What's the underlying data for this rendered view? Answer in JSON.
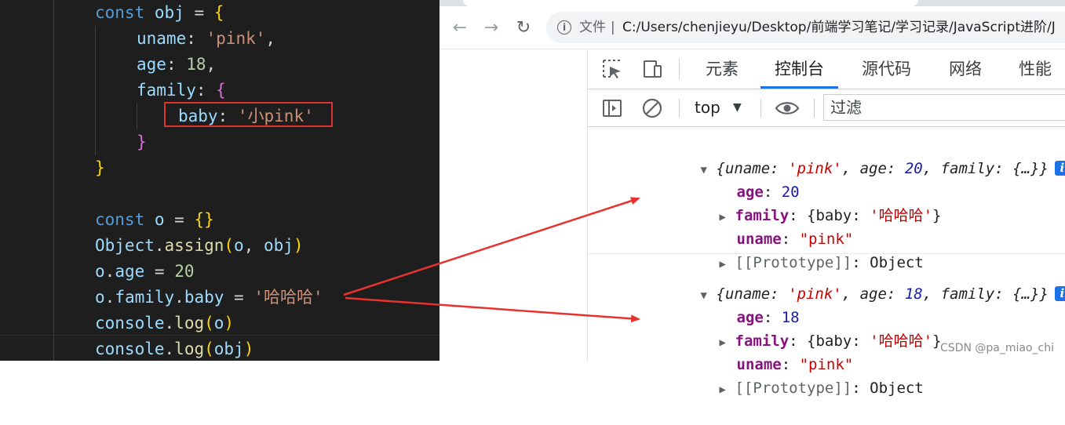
{
  "editor": {
    "lines": [
      {
        "id": "l1",
        "tokens": [
          [
            "kw",
            "const "
          ],
          [
            "var",
            "obj"
          ],
          [
            "vr",
            " = "
          ],
          [
            "br1",
            "{"
          ]
        ]
      },
      {
        "id": "l2",
        "tokens": [
          [
            "var",
            "uname"
          ],
          [
            "vr",
            ": "
          ],
          [
            "str",
            "'pink'"
          ],
          [
            "vr",
            ","
          ]
        ]
      },
      {
        "id": "l3",
        "tokens": [
          [
            "var",
            "age"
          ],
          [
            "vr",
            ": "
          ],
          [
            "num",
            "18"
          ],
          [
            "vr",
            ","
          ]
        ]
      },
      {
        "id": "l4",
        "tokens": [
          [
            "var",
            "family"
          ],
          [
            "vr",
            ": "
          ],
          [
            "br2",
            "{"
          ]
        ]
      },
      {
        "id": "l5",
        "tokens": [
          [
            "var",
            "baby"
          ],
          [
            "vr",
            ": "
          ],
          [
            "str",
            "'小pink'"
          ]
        ]
      },
      {
        "id": "l6",
        "tokens": [
          [
            "br2",
            "}"
          ]
        ]
      },
      {
        "id": "l7",
        "tokens": [
          [
            "br1",
            "}"
          ]
        ]
      },
      {
        "id": "l8",
        "tokens": []
      },
      {
        "id": "l9",
        "tokens": [
          [
            "kw",
            "const "
          ],
          [
            "var",
            "o"
          ],
          [
            "vr",
            " = "
          ],
          [
            "br1",
            "{}"
          ]
        ]
      },
      {
        "id": "l10",
        "tokens": [
          [
            "var",
            "Object"
          ],
          [
            "vr",
            "."
          ],
          [
            "fn",
            "assign"
          ],
          [
            "br1",
            "("
          ],
          [
            "var",
            "o"
          ],
          [
            "vr",
            ", "
          ],
          [
            "var",
            "obj"
          ],
          [
            "br1",
            ")"
          ]
        ]
      },
      {
        "id": "l11",
        "tokens": [
          [
            "var",
            "o"
          ],
          [
            "vr",
            "."
          ],
          [
            "var",
            "age"
          ],
          [
            "vr",
            " = "
          ],
          [
            "num",
            "20"
          ]
        ]
      },
      {
        "id": "l12",
        "tokens": [
          [
            "var",
            "o"
          ],
          [
            "vr",
            "."
          ],
          [
            "var",
            "family"
          ],
          [
            "vr",
            "."
          ],
          [
            "var",
            "baby"
          ],
          [
            "vr",
            " = "
          ],
          [
            "str",
            "'哈哈哈'"
          ]
        ]
      },
      {
        "id": "l13",
        "tokens": [
          [
            "var",
            "console"
          ],
          [
            "vr",
            "."
          ],
          [
            "fn",
            "log"
          ],
          [
            "br1",
            "("
          ],
          [
            "var",
            "o"
          ],
          [
            "br1",
            ")"
          ]
        ]
      },
      {
        "id": "l14",
        "tokens": [
          [
            "var",
            "console"
          ],
          [
            "vr",
            "."
          ],
          [
            "fn",
            "log"
          ],
          [
            "br1",
            "("
          ],
          [
            "var",
            "obj"
          ],
          [
            "br1",
            ")"
          ]
        ]
      }
    ]
  },
  "browser": {
    "nav": {
      "back": "←",
      "forward": "→",
      "reload": "↻"
    },
    "address": {
      "info_icon": "i",
      "file_label": "文件",
      "separator": "|",
      "url": "C:/Users/chenjieyu/Desktop/前端学习笔记/学习记录/JavaScript进阶/J"
    }
  },
  "devtools": {
    "tabs": [
      "元素",
      "控制台",
      "源代码",
      "网络",
      "性能"
    ],
    "active_tab": "控制台",
    "context": "top",
    "filter_placeholder": "过滤",
    "logs": [
      {
        "summary": {
          "open": "{",
          "uname_key": "uname",
          "uname_val": "'pink'",
          "age_key": "age",
          "age_val": "20",
          "family_key": "family",
          "family_val": "{…}",
          "close": "}"
        },
        "age_key": "age",
        "age_val": "20",
        "family_key": "family",
        "family_inner": "{baby: '哈哈哈'}",
        "baby_key": "baby",
        "baby_val": "'哈哈哈'",
        "uname_key": "uname",
        "uname_val": "\"pink\"",
        "proto_key": "[[Prototype]]",
        "proto_val": "Object"
      },
      {
        "summary": {
          "open": "{",
          "uname_key": "uname",
          "uname_val": "'pink'",
          "age_key": "age",
          "age_val": "18",
          "family_key": "family",
          "family_val": "{…}",
          "close": "}"
        },
        "age_key": "age",
        "age_val": "18",
        "family_key": "family",
        "family_inner": "{baby: '哈哈哈'}",
        "baby_key": "baby",
        "baby_val": "'哈哈哈'",
        "uname_key": "uname",
        "uname_val": "\"pink\"",
        "proto_key": "[[Prototype]]",
        "proto_val": "Object"
      }
    ]
  },
  "watermark": "CSDN @pa_miao_chi",
  "colors": {
    "arrow": "#e8322e",
    "highlight_box": "#e0322f",
    "tab_accent": "#1a73e8"
  },
  "icons": [
    "back-arrow-icon",
    "forward-arrow-icon",
    "reload-icon",
    "info-circle-icon",
    "inspect-element-icon",
    "device-toolbar-icon",
    "sidebar-toggle-icon",
    "clear-console-icon",
    "eye-icon",
    "info-badge-icon"
  ]
}
